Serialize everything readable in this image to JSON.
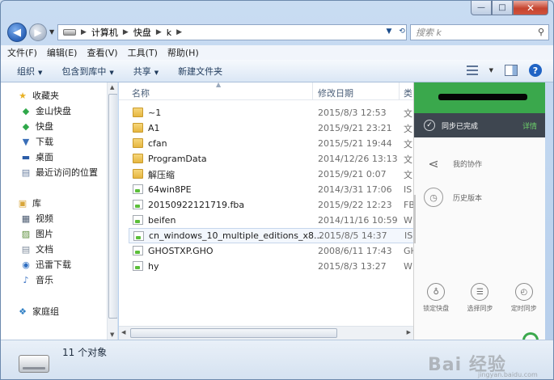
{
  "window": {
    "caption": {
      "minimize": "—",
      "maximize": "□",
      "close": "✕"
    }
  },
  "address": {
    "crumbs": [
      "计算机",
      "快盘",
      "k"
    ],
    "search_placeholder": "搜索 k"
  },
  "menu": [
    "文件(F)",
    "编辑(E)",
    "查看(V)",
    "工具(T)",
    "帮助(H)"
  ],
  "toolbar": {
    "organize": "组织",
    "include_library": "包含到库中",
    "share": "共享",
    "new_folder": "新建文件夹"
  },
  "nav": {
    "favorites": "收藏夹",
    "fav_items": [
      "金山快盘",
      "快盘",
      "下载",
      "桌面",
      "最近访问的位置"
    ],
    "libraries": "库",
    "lib_items": [
      "视频",
      "图片",
      "文档",
      "迅雷下载",
      "音乐"
    ],
    "homegroup": "家庭组"
  },
  "columns": {
    "name": "名称",
    "date": "修改日期",
    "type": "类"
  },
  "files": [
    {
      "name": "~1",
      "date": "2015/8/3 12:53",
      "type": "文",
      "kind": "folder"
    },
    {
      "name": "A1",
      "date": "2015/9/21 23:21",
      "type": "文",
      "kind": "folder"
    },
    {
      "name": "cfan",
      "date": "2015/5/21 19:44",
      "type": "文",
      "kind": "folder"
    },
    {
      "name": "ProgramData",
      "date": "2014/12/26 13:13",
      "type": "文",
      "kind": "folder"
    },
    {
      "name": "解压缩",
      "date": "2015/9/21 0:07",
      "type": "文",
      "kind": "folder"
    },
    {
      "name": "64win8PE",
      "date": "2014/3/31 17:06",
      "type": "IS",
      "kind": "file"
    },
    {
      "name": "20150922121719.fba",
      "date": "2015/9/22 12:23",
      "type": "FB",
      "kind": "file"
    },
    {
      "name": "beifen",
      "date": "2014/11/16 10:59",
      "type": "W",
      "kind": "file"
    },
    {
      "name": "cn_windows_10_multiple_editions_x8...",
      "date": "2015/8/5 14:37",
      "type": "IS",
      "kind": "file"
    },
    {
      "name": "GHOSTXP.GHO",
      "date": "2008/6/11 17:43",
      "type": "GH",
      "kind": "file"
    },
    {
      "name": "hy",
      "date": "2015/8/3 13:27",
      "type": "W",
      "kind": "file"
    }
  ],
  "sync": {
    "status": "同步已完成",
    "detail": "详情",
    "my_collab": "我的协作",
    "history": "历史版本",
    "bottom": [
      "锁定快盘",
      "选择同步",
      "定时同步"
    ],
    "colors": {
      "head": "#3aa84c",
      "status_bg": "#3e4650",
      "detail": "#6ccf6a"
    }
  },
  "status": {
    "count": "11 个对象"
  },
  "watermark": {
    "main": "Bai 经验",
    "sub": "jingyan.baidu.com"
  }
}
